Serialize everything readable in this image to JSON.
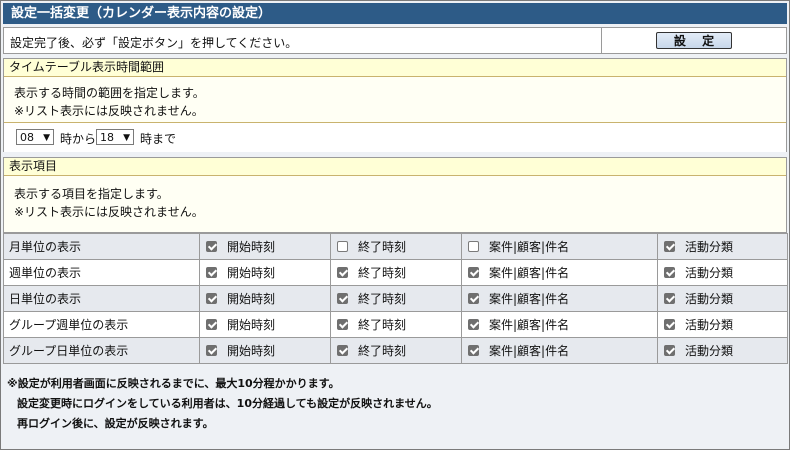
{
  "title": "設定一括変更（カレンダー表示内容の設定）",
  "notice": {
    "text": "設定完了後、必ず「設定ボタン」を押してください。",
    "button_label": "設 定"
  },
  "time_section": {
    "heading": "タイムテーブル表示時間範囲",
    "desc_line1": "表示する時間の範囲を指定します。",
    "desc_line2": "※リスト表示には反映されません。",
    "start_hour": "08",
    "from_label": "時から",
    "end_hour": "18",
    "until_label": "時まで"
  },
  "items_section": {
    "heading": "表示項目",
    "desc_line1": "表示する項目を指定します。",
    "desc_line2": "※リスト表示には反映されません。"
  },
  "columns": [
    "開始時刻",
    "終了時刻",
    "案件|顧客|件名",
    "活動分類"
  ],
  "rows": [
    {
      "label": "月単位の表示",
      "checks": [
        true,
        false,
        false,
        true
      ]
    },
    {
      "label": "週単位の表示",
      "checks": [
        true,
        true,
        true,
        true
      ]
    },
    {
      "label": "日単位の表示",
      "checks": [
        true,
        true,
        true,
        true
      ]
    },
    {
      "label": "グループ週単位の表示",
      "checks": [
        true,
        true,
        true,
        true
      ]
    },
    {
      "label": "グループ日単位の表示",
      "checks": [
        true,
        true,
        true,
        true
      ]
    }
  ],
  "footer": {
    "line1": "※設定が利用者画面に反映されるまでに、最大10分程かかります。",
    "line2": "設定変更時にログインをしている利用者は、10分経過しても設定が反映されません。",
    "line3": "再ログイン後に、設定が反映されます。"
  }
}
